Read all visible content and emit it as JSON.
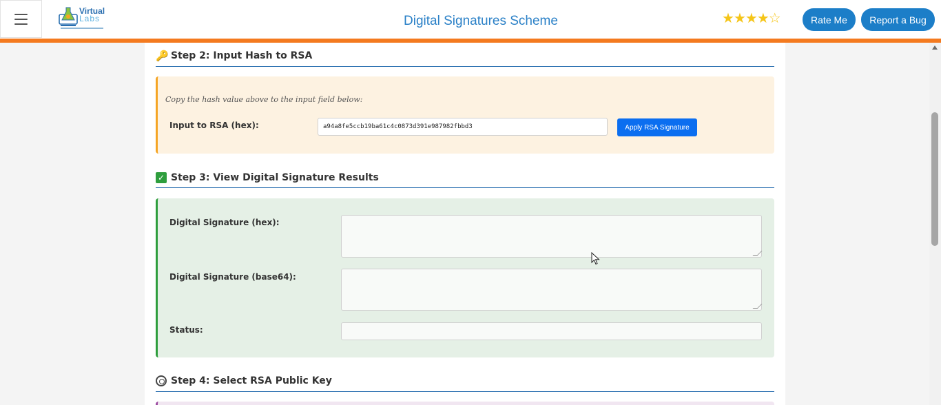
{
  "header": {
    "title": "Digital Signatures Scheme",
    "logo_line1": "Virtual",
    "logo_line2": "Labs",
    "rating": 4,
    "rating_max": 5,
    "rate_label": "Rate Me",
    "bug_label": "Report a Bug",
    "accent_color": "#f47a1f",
    "button_color": "#1c7ec8"
  },
  "step2": {
    "title": "Step 2: Input Hash to RSA",
    "icon": "key-icon",
    "hint": "Copy the hash value above to the input field below:",
    "input_label": "Input to RSA (hex):",
    "input_value": "a94a8fe5ccb19ba61c4c0873d391e987982fbbd3",
    "apply_label": "Apply RSA Signature"
  },
  "step3": {
    "title": "Step 3: View Digital Signature Results",
    "icon": "checkmark-icon",
    "hex_label": "Digital Signature (hex):",
    "hex_value": "",
    "base64_label": "Digital Signature (base64):",
    "base64_value": "",
    "status_label": "Status:",
    "status_value": ""
  },
  "step4": {
    "title": "Step 4: Select RSA Public Key",
    "icon": "gear-icon"
  }
}
